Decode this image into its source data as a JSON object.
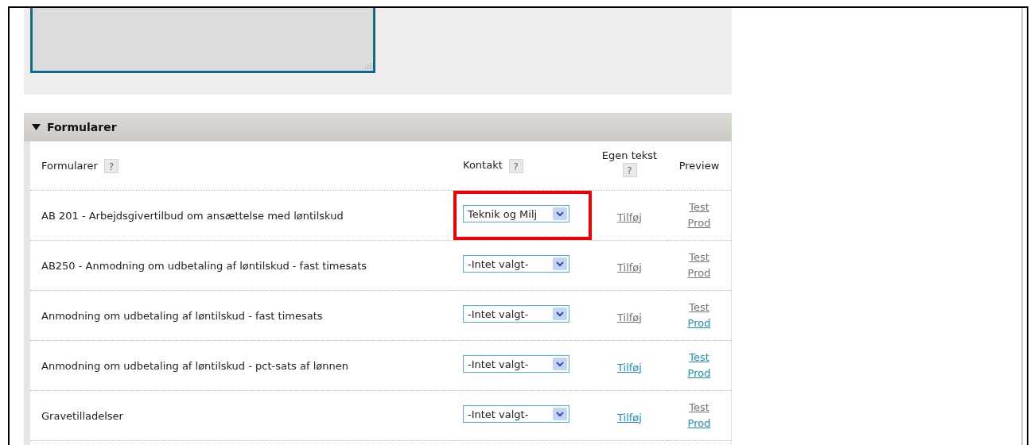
{
  "section": {
    "title": "Formularer",
    "expanded": true
  },
  "columns": [
    {
      "label": "Formularer",
      "help": "?"
    },
    {
      "label": "Kontakt",
      "help": "?"
    },
    {
      "label": "Egen tekst",
      "help": "?"
    },
    {
      "label": "Preview"
    }
  ],
  "rows": [
    {
      "name": "AB 201 - Arbejdsgivertilbud om ansættelse med løntilskud",
      "contact": "Teknik og Milj",
      "highlighted": true,
      "add": {
        "label": "Tilføj",
        "visited": true
      },
      "test": {
        "label": "Test",
        "visited": true
      },
      "prod": {
        "label": "Prod",
        "visited": true
      }
    },
    {
      "name": "AB250 - Anmodning om udbetaling af løntilskud - fast timesats",
      "contact": "-Intet valgt-",
      "highlighted": false,
      "add": {
        "label": "Tilføj",
        "visited": true
      },
      "test": {
        "label": "Test",
        "visited": true
      },
      "prod": {
        "label": "Prod",
        "visited": true
      }
    },
    {
      "name": "Anmodning om udbetaling af løntilskud - fast timesats",
      "contact": "-Intet valgt-",
      "highlighted": false,
      "add": {
        "label": "Tilføj",
        "visited": true
      },
      "test": {
        "label": "Test",
        "visited": true
      },
      "prod": {
        "label": "Prod",
        "visited": false
      }
    },
    {
      "name": "Anmodning om udbetaling af løntilskud - pct-sats af lønnen",
      "contact": "-Intet valgt-",
      "highlighted": false,
      "add": {
        "label": "Tilføj",
        "visited": false
      },
      "test": {
        "label": "Test",
        "visited": false
      },
      "prod": {
        "label": "Prod",
        "visited": false
      }
    },
    {
      "name": "Gravetilladelser",
      "contact": "-Intet valgt-",
      "highlighted": false,
      "add": {
        "label": "Tilføj",
        "visited": false
      },
      "test": {
        "label": "Test",
        "visited": true
      },
      "prod": {
        "label": "Prod",
        "visited": false
      }
    }
  ]
}
